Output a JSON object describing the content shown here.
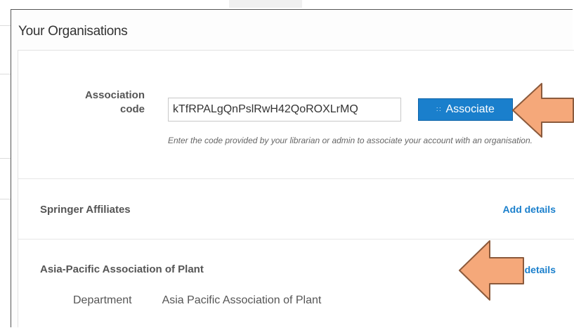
{
  "panel": {
    "title": "Your Organisations"
  },
  "association": {
    "label": "Association code",
    "input_value": "kTfRPALgQnPslRwH42QoROXLrMQ",
    "button_label": "Associate",
    "button_icon": "list-icon",
    "help_text": "Enter the code provided by your librarian or admin to associate your account with an organisation."
  },
  "organisations": [
    {
      "name": "Springer Affiliates",
      "action": "Add details"
    },
    {
      "name": "Asia-Pacific Association of Plant",
      "action": "Add details",
      "department_label": "Department",
      "department_value": "Asia Pacific Association of Plant"
    }
  ],
  "annotations": {
    "arrow_color": "#f5a87a",
    "arrow_border": "#8b5a3c"
  },
  "colors": {
    "accent": "#1a7fcc",
    "text": "#555555"
  }
}
